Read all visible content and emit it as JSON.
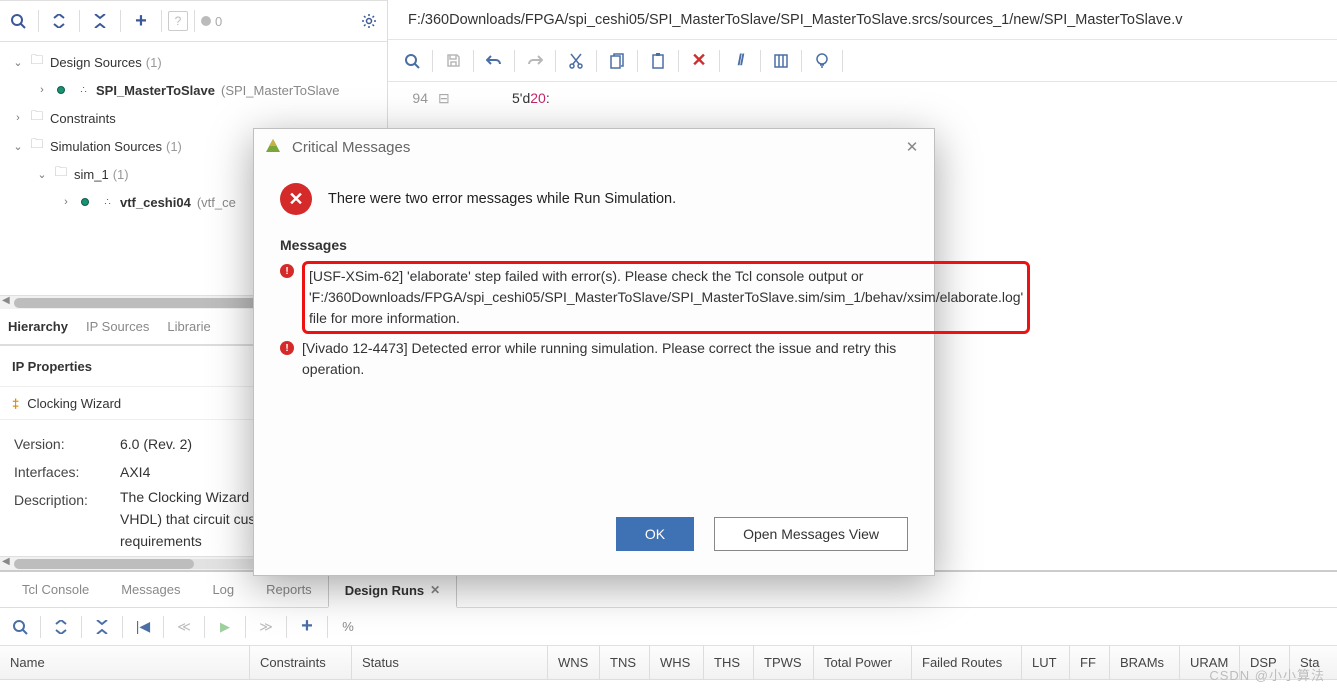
{
  "left": {
    "toolbar": {
      "badge_count": "0"
    },
    "tree": {
      "design_sources": {
        "label": "Design Sources",
        "count": "(1)"
      },
      "spi_master": {
        "label": "SPI_MasterToSlave",
        "suffix": "(SPI_MasterToSlave"
      },
      "constraints": {
        "label": "Constraints"
      },
      "sim_sources": {
        "label": "Simulation Sources",
        "count": "(1)"
      },
      "sim1": {
        "label": "sim_1",
        "count": "(1)"
      },
      "vtf": {
        "label": "vtf_ceshi04",
        "suffix": "(vtf_ce"
      }
    },
    "tabs": {
      "hierarchy": "Hierarchy",
      "ip": "IP Sources",
      "lib": "Librarie"
    }
  },
  "ip": {
    "title": "IP Properties",
    "sub": "Clocking Wizard",
    "rows": {
      "version_k": "Version:",
      "version_v": "6.0 (Rev. 2)",
      "iface_k": "Interfaces:",
      "iface_v": "AXI4",
      "desc_k": "Description:",
      "desc_v": "The Clocking Wizard c (Verilog or VHDL) that circuit customized to t requirements"
    }
  },
  "editor": {
    "path": "F:/360Downloads/FPGA/spi_ceshi05/SPI_MasterToSlave/SPI_MasterToSlave.srcs/sources_1/new/SPI_MasterToSlave.v",
    "line_no": "94",
    "code_a": "5'd",
    "code_b": "20",
    "code_c": ":"
  },
  "dialog": {
    "title": "Critical Messages",
    "lead": "There were two error messages while Run Simulation.",
    "section": "Messages",
    "msg1_a": "[USF-XSim-62] 'elaborate' step failed with error(s). Please check the Tcl console output or",
    "msg1_b": "'F:/360Downloads/FPGA/spi_ceshi05/SPI_MasterToSlave/SPI_MasterToSlave.sim/sim_1/behav/xsim/elaborate.log' file for more information.",
    "msg2": "[Vivado 12-4473] Detected error while running simulation. Please correct the issue and retry this operation.",
    "ok": "OK",
    "open": "Open Messages View"
  },
  "bottom": {
    "tabs": {
      "tcl": "Tcl Console",
      "msg": "Messages",
      "log": "Log",
      "rep": "Reports",
      "runs": "Design Runs"
    },
    "headers": {
      "name": "Name",
      "constraints": "Constraints",
      "status": "Status",
      "wns": "WNS",
      "tns": "TNS",
      "whs": "WHS",
      "ths": "THS",
      "tpws": "TPWS",
      "tpower": "Total Power",
      "froutes": "Failed Routes",
      "lut": "LUT",
      "ff": "FF",
      "brams": "BRAMs",
      "uram": "URAM",
      "dsp": "DSP",
      "sta": "Sta"
    }
  },
  "watermark": "CSDN @小小算法"
}
